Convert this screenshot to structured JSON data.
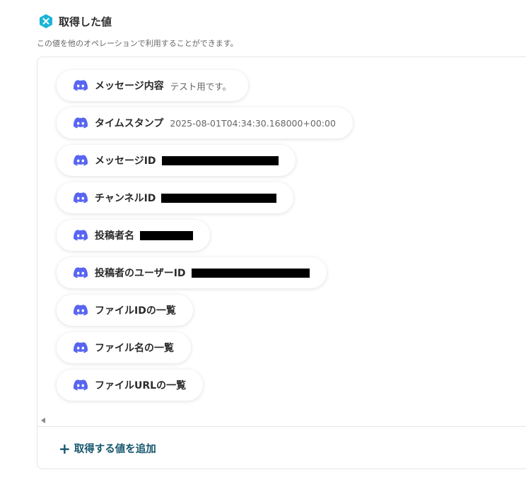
{
  "section": {
    "title": "取得した値",
    "logo_icon": "x-badge-icon",
    "subtitle": "この値を他のオペレーションで利用することができます。"
  },
  "fields": [
    {
      "label": "メッセージ内容",
      "value": "テスト用です。",
      "redacted": false,
      "icon": "discord-icon"
    },
    {
      "label": "タイムスタンプ",
      "value": "2025-08-01T04:34:30.168000+00:00",
      "redacted": false,
      "icon": "discord-icon"
    },
    {
      "label": "メッセージID",
      "value": "",
      "redacted": true,
      "icon": "discord-icon"
    },
    {
      "label": "チャンネルID",
      "value": "",
      "redacted": true,
      "icon": "discord-icon"
    },
    {
      "label": "投稿者名",
      "value": "",
      "redacted": true,
      "icon": "discord-icon"
    },
    {
      "label": "投稿者のユーザーID",
      "value": "",
      "redacted": true,
      "icon": "discord-icon"
    },
    {
      "label": "ファイルIDの一覧",
      "value": "",
      "redacted": false,
      "icon": "discord-icon"
    },
    {
      "label": "ファイル名の一覧",
      "value": "",
      "redacted": false,
      "icon": "discord-icon"
    },
    {
      "label": "ファイルURLの一覧",
      "value": "",
      "redacted": false,
      "icon": "discord-icon"
    }
  ],
  "add_button": {
    "label": "取得する値を追加",
    "icon": "plus-icon"
  },
  "colors": {
    "discord": "#5865F2",
    "accent": "#15566c",
    "logo": "#19b5d8"
  }
}
